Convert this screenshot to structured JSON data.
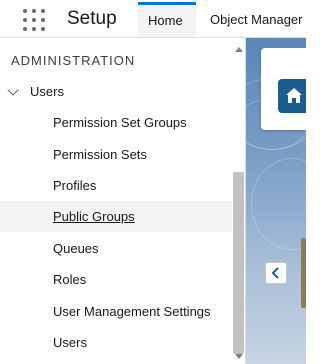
{
  "header": {
    "app_launcher_icon": "app-launcher-waffle-icon",
    "app_title": "Setup",
    "tabs": [
      {
        "label": "Home",
        "active": true
      },
      {
        "label": "Object Manager",
        "active": false
      }
    ]
  },
  "sidebar": {
    "section_title": "ADMINISTRATION",
    "parent": {
      "label": "Users",
      "expanded": true,
      "icon": "chevron-down-icon"
    },
    "items": [
      {
        "label": "Permission Set Groups",
        "selected": false
      },
      {
        "label": "Permission Sets",
        "selected": false
      },
      {
        "label": "Profiles",
        "selected": false
      },
      {
        "label": "Public Groups",
        "selected": true
      },
      {
        "label": "Queues",
        "selected": false
      },
      {
        "label": "Roles",
        "selected": false
      },
      {
        "label": "User Management Settings",
        "selected": false
      },
      {
        "label": "Users",
        "selected": false
      }
    ]
  },
  "content": {
    "home_icon": "home-icon",
    "collapse_icon": "chevron-left-icon"
  },
  "colors": {
    "accent": "#0176d3",
    "home_icon_bg": "#1b5d8e",
    "selected_row_bg": "#f3f3f3"
  }
}
